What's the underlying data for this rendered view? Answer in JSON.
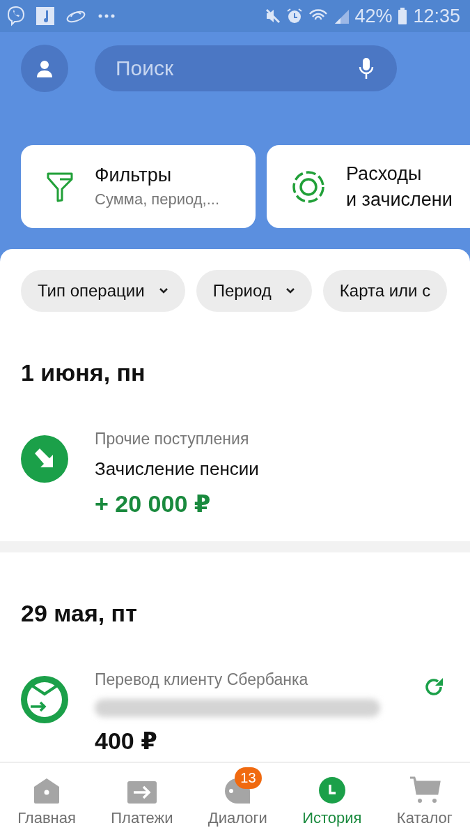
{
  "status_bar": {
    "battery": "42%",
    "time": "12:35"
  },
  "search": {
    "placeholder": "Поиск"
  },
  "quick_cards": [
    {
      "kind": "filter",
      "title": "Фильтры",
      "subtitle": "Сумма, период,..."
    },
    {
      "kind": "ring",
      "title": "Расходы",
      "subtitle": "и зачислени"
    }
  ],
  "chips": [
    {
      "label": "Тип операции",
      "dropdown": true
    },
    {
      "label": "Период",
      "dropdown": true
    },
    {
      "label": "Карта или с",
      "dropdown": false
    }
  ],
  "days": [
    {
      "date": "1 июня, пн",
      "operations": [
        {
          "kind": "income",
          "category": "Прочие поступления",
          "name_hidden": false,
          "name": "Зачисление пенсии",
          "amount": "+ 20 000 ₽",
          "positive": true,
          "repeat": false
        }
      ]
    },
    {
      "date": "29 мая, пт",
      "operations": [
        {
          "kind": "transfer",
          "category": "Перевод клиенту Сбербанка",
          "name_hidden": true,
          "amount": "400 ₽",
          "positive": false,
          "repeat": true
        }
      ]
    }
  ],
  "nav": [
    {
      "kind": "home",
      "label": "Главная",
      "selected": false
    },
    {
      "kind": "payments",
      "label": "Платежи",
      "selected": false
    },
    {
      "kind": "dialogs",
      "label": "Диалоги",
      "selected": false,
      "badge": "13"
    },
    {
      "kind": "history",
      "label": "История",
      "selected": true
    },
    {
      "kind": "catalog",
      "label": "Каталог",
      "selected": false
    }
  ]
}
